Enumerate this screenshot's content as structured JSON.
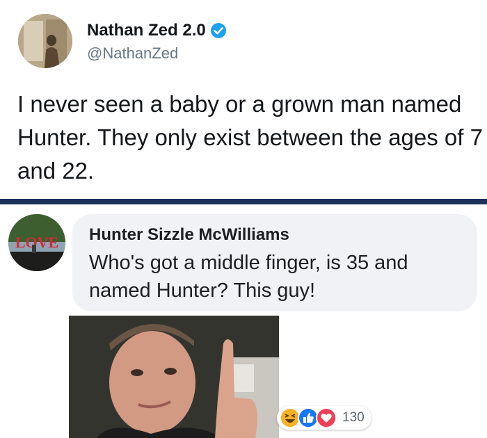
{
  "tweet": {
    "display_name": "Nathan Zed 2.0",
    "handle": "@NathanZed",
    "text": "I never seen a baby or a grown man named Hunter. They only exist between the ages of 7 and 22.",
    "verified_icon": "verified-badge-icon"
  },
  "comment": {
    "commenter_name": "Hunter Sizzle McWilliams",
    "text": "Who's got a middle finger, is 35 and named Hunter? This guy!",
    "avatar_sign_text": "LOVE",
    "reactions": {
      "icons": [
        "haha-icon",
        "like-icon",
        "love-icon"
      ],
      "count": "130"
    }
  },
  "colors": {
    "divider": "#1b3158",
    "verified": "#1da1f2",
    "like": "#1877f2",
    "love": "#f33e58",
    "haha": "#f7b125"
  }
}
